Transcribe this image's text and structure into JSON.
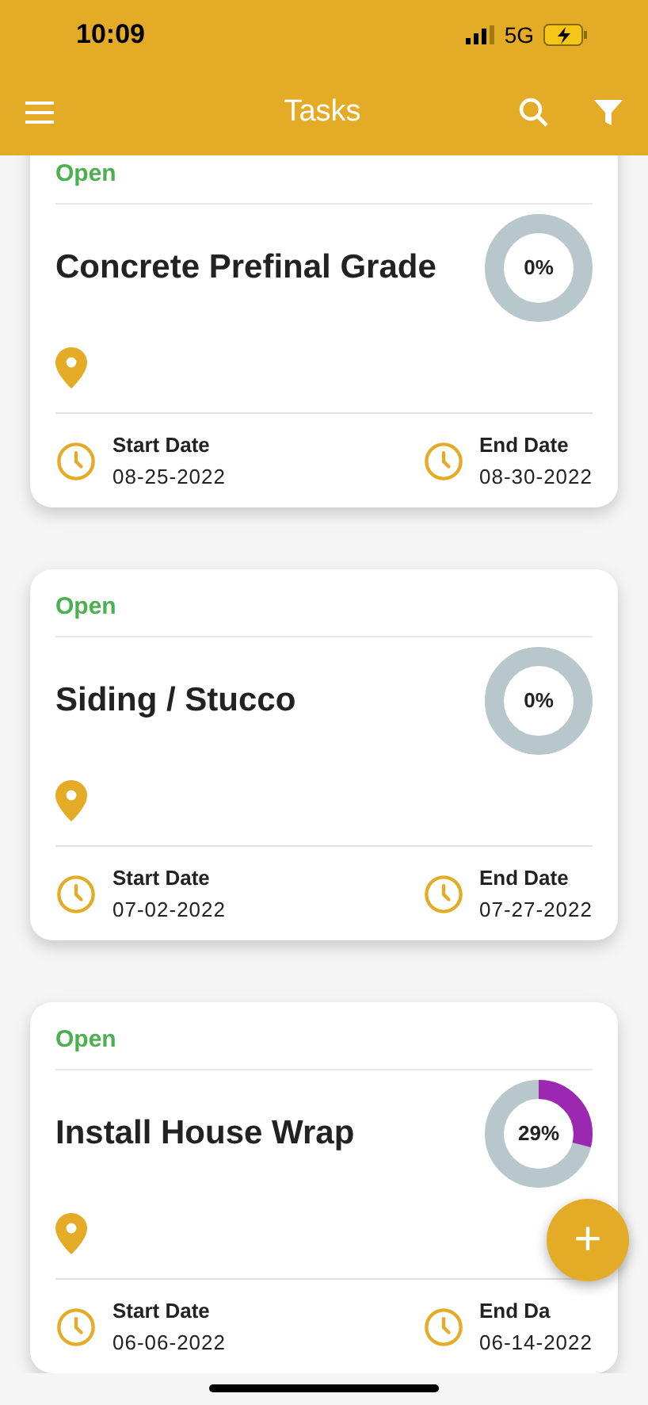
{
  "status_bar": {
    "time": "10:09",
    "network": "5G"
  },
  "header": {
    "title": "Tasks"
  },
  "tasks": [
    {
      "status": "Open",
      "title": "Concrete Prefinal Grade",
      "percent": "0%",
      "start_label": "Start Date",
      "start": "08-25-2022",
      "end_label": "End Date",
      "end": "08-30-2022"
    },
    {
      "status": "Open",
      "title": "Siding / Stucco",
      "percent": "0%",
      "start_label": "Start Date",
      "start": "07-02-2022",
      "end_label": "End Date",
      "end": "07-27-2022"
    },
    {
      "status": "Open",
      "title": "Install House Wrap",
      "percent": "29%",
      "start_label": "Start Date",
      "start": "06-06-2022",
      "end_label": "End Da",
      "end": "06-14-2022"
    }
  ],
  "fab": {
    "label": "+"
  }
}
